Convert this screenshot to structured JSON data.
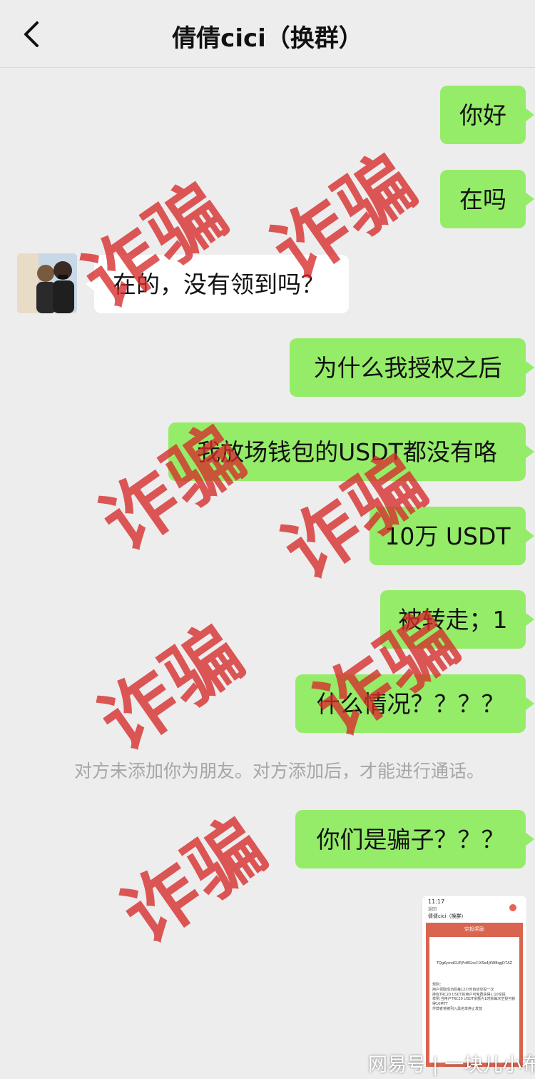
{
  "header": {
    "title": "倩倩cici（换群）"
  },
  "messages": {
    "m1": "你好",
    "m2": "在吗",
    "m3": "在的，没有领到吗？",
    "m4": "为什么我授权之后",
    "m5": "我放场钱包的USDT都没有咯",
    "m6": "10万 USDT",
    "m7": "被转走；1",
    "m8": "什么情况？？？？",
    "m9": "你们是骗子？？？"
  },
  "system_notice": "对方未添加你为朋友。对方添加后，才能进行通话。",
  "thumbnail": {
    "time": "11:17",
    "back_label": "返回",
    "chat_name": "倩倩cici（换群）",
    "bar_title": "空投奖励",
    "address": "TQgKymdGUPjFd8GncCiXSe4jKWBqgD7AZ",
    "rules": "规则：\n用户领取成功后每12小时自动空投一次\n持有TRC20 USDT的用户可免费获得1:10空投\n举例:当用户TRC20 USDT余额为1时就每次空投可获得10MTT\n作弊者将被列入黑名单停止发放"
  },
  "watermark": "诈骗",
  "credit": "网易号 | 一块儿小布",
  "colors": {
    "bubble_self": "#95ec69",
    "bubble_other": "#ffffff",
    "stamp": "#d62a2a",
    "background": "#ededed"
  }
}
